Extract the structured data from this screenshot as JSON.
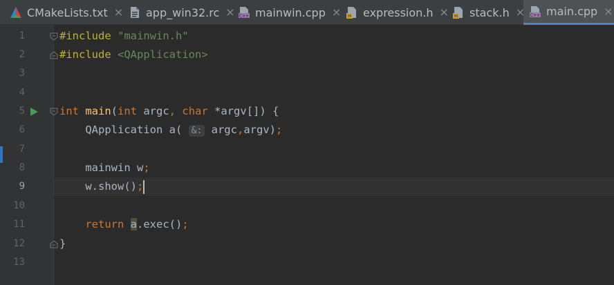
{
  "tabs": [
    {
      "label": "CMakeLists.txt",
      "icon": "cmake-icon"
    },
    {
      "label": "app_win32.rc",
      "icon": "file-icon"
    },
    {
      "label": "mainwin.cpp",
      "icon": "cpp-file-icon"
    },
    {
      "label": "expression.h",
      "icon": "header-file-icon"
    },
    {
      "label": "stack.h",
      "icon": "header-file-icon"
    },
    {
      "label": "main.cpp",
      "icon": "cpp-file-icon",
      "active": true
    }
  ],
  "close_glyph": "×",
  "gutter": {
    "line_numbers": [
      "1",
      "2",
      "3",
      "4",
      "5",
      "6",
      "7",
      "8",
      "9",
      "10",
      "11",
      "12",
      "13"
    ],
    "current_line": "9"
  },
  "code": {
    "l1": {
      "directive": "#include",
      "arg": "\"mainwin.h\""
    },
    "l2": {
      "directive": "#include",
      "arg": "<QApplication>"
    },
    "l5": {
      "kw1": "int",
      "name": "main",
      "p1": "(",
      "kw2": "int",
      "v1": " argc",
      "comma": ",",
      "kw3": "char",
      "v2": " *argv[]",
      "tail": ") {"
    },
    "l6": {
      "type": "QApplication",
      "var": " a(",
      "hint": "&:",
      "args": " argc",
      "comma": ",",
      "args2": "argv)",
      "semi": ";"
    },
    "l8": {
      "type": "mainwin",
      "var": " w",
      "semi": ";"
    },
    "l9": {
      "call": "w.show()",
      "semi": ";"
    },
    "l11": {
      "kw": "return",
      "var": "a",
      "call": ".exec()",
      "semi": ";"
    },
    "l12": {
      "brace": "}"
    }
  },
  "colors": {
    "background": "#2b2b2b",
    "keyword": "#cc7832",
    "string": "#6a8759",
    "accent": "#4a88c7",
    "run_icon": "#499c54"
  }
}
